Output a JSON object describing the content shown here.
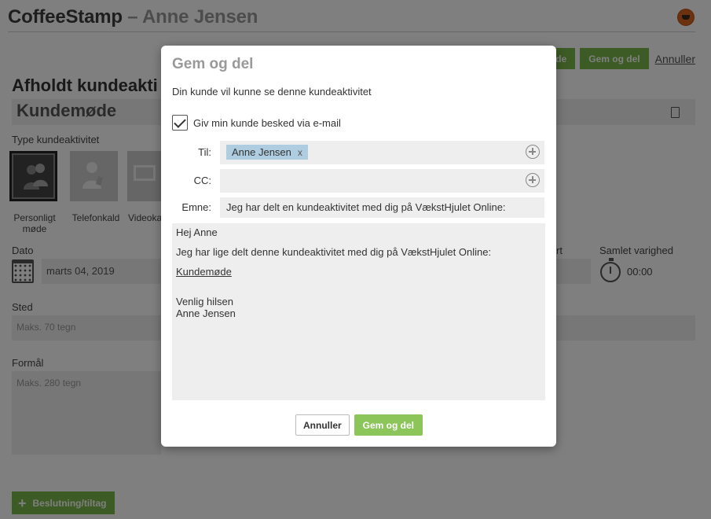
{
  "app": {
    "name": "CoffeeStamp",
    "separator": "–",
    "user": "Anne Jensen",
    "brand_color": "#7ab648"
  },
  "toolbar": {
    "partial_button_label": "de",
    "save_share_label": "Gem og del",
    "cancel_label": "Annuller"
  },
  "page": {
    "section_title": "Afholdt kundeakti",
    "activity_name": "Kundemøde",
    "type_label": "Type kundeaktivitet",
    "types": [
      "Personligt møde",
      "Telefonkald",
      "Videoka"
    ],
    "date_label": "Dato",
    "date_value": "marts 04, 2019",
    "end_label_partial": "rt",
    "duration_label": "Samlet varighed",
    "duration_value": "00:00",
    "place_label": "Sted",
    "place_placeholder": "Maks. 70 tegn",
    "purpose_label": "Formål",
    "purpose_placeholder": "Maks. 280 tegn",
    "decision_button_label": "Beslutning/tiltag"
  },
  "modal": {
    "title": "Gem og del",
    "description": "Din kunde vil kunne se denne kundeaktivitet",
    "notify_checkbox_label": "Giv min kunde besked via e-mail",
    "notify_checked": true,
    "to_label": "Til:",
    "to_recipient": "Anne Jensen",
    "remove_glyph": "x",
    "cc_label": "CC:",
    "subject_label": "Emne:",
    "subject_value": "Jeg har delt en kundeaktivitet med dig på VækstHjulet Online:",
    "message": {
      "greeting": "Hej Anne",
      "body": "Jeg har lige delt denne kundeaktivitet med dig på VækstHjulet Online:",
      "link_text": "Kundemøde",
      "closing": "Venlig hilsen",
      "signature": "Anne Jensen"
    },
    "cancel_label": "Annuller",
    "save_label": "Gem og del"
  }
}
